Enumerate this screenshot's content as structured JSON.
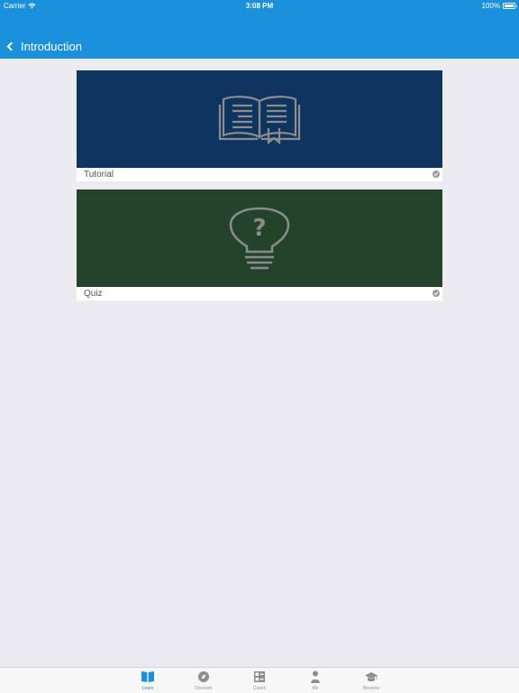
{
  "status_bar": {
    "carrier": "Carrier",
    "time": "3:08 PM",
    "battery": "100%"
  },
  "nav": {
    "title": "Introduction"
  },
  "cards": [
    {
      "label": "Tutorial",
      "image_icon": "open-book-icon",
      "bg": "#0d3560"
    },
    {
      "label": "Quiz",
      "image_icon": "lightbulb-question-icon",
      "bg": "#23442a"
    }
  ],
  "tabs": [
    {
      "label": "Learn",
      "icon": "book-icon",
      "active": true
    },
    {
      "label": "Discover",
      "icon": "compass-icon",
      "active": false
    },
    {
      "label": "Coach",
      "icon": "checklist-icon",
      "active": false
    },
    {
      "label": "Me",
      "icon": "person-icon",
      "active": false
    },
    {
      "label": "Become",
      "icon": "graduation-cap-icon",
      "active": false
    }
  ],
  "colors": {
    "accent": "#1b90db",
    "background": "#ebebf0",
    "inactive_tab": "#929292"
  }
}
